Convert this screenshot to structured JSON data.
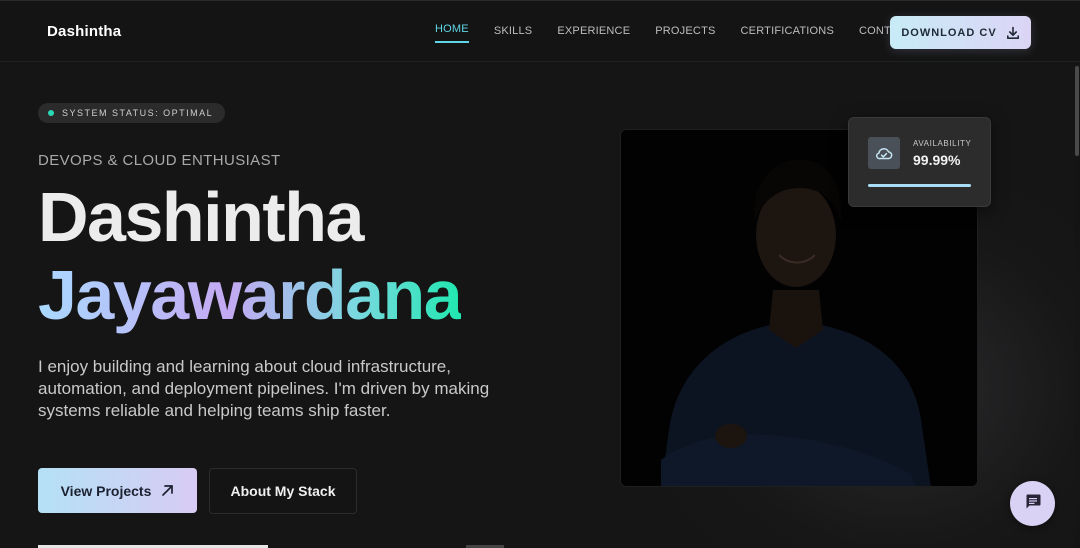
{
  "brand": {
    "name": "Dashintha"
  },
  "nav": {
    "items": [
      {
        "label": "HOME",
        "active": true
      },
      {
        "label": "SKILLS",
        "active": false
      },
      {
        "label": "EXPERIENCE",
        "active": false
      },
      {
        "label": "PROJECTS",
        "active": false
      },
      {
        "label": "CERTIFICATIONS",
        "active": false
      },
      {
        "label": "CONTACT",
        "active": false
      }
    ],
    "download_label": "DOWNLOAD CV",
    "download_icon": "download-icon"
  },
  "hero": {
    "status": "SYSTEM STATUS: OPTIMAL",
    "eyebrow": "DEVOPS & CLOUD ENTHUSIAST",
    "first_name": "Dashintha",
    "last_name": "Jayawardana",
    "bio": "I enjoy building and learning about cloud infrastructure, automation, and deployment pipelines. I'm driven by making systems reliable and helping teams ship faster.",
    "primary_cta": "View Projects",
    "primary_icon": "arrow-up-right-icon",
    "secondary_cta": "About My Stack"
  },
  "availability": {
    "label": "AVAILABILITY",
    "value": "99.99%",
    "fraction": 0.9999,
    "icon": "cloud-check-icon"
  },
  "chat": {
    "icon": "chat-icon"
  },
  "colors": {
    "accent": "#5fd6e8",
    "status_dot": "#2bd8b6",
    "background": "#151515",
    "gradient_start": "#a9d9ff",
    "gradient_end": "#20e8b0"
  }
}
